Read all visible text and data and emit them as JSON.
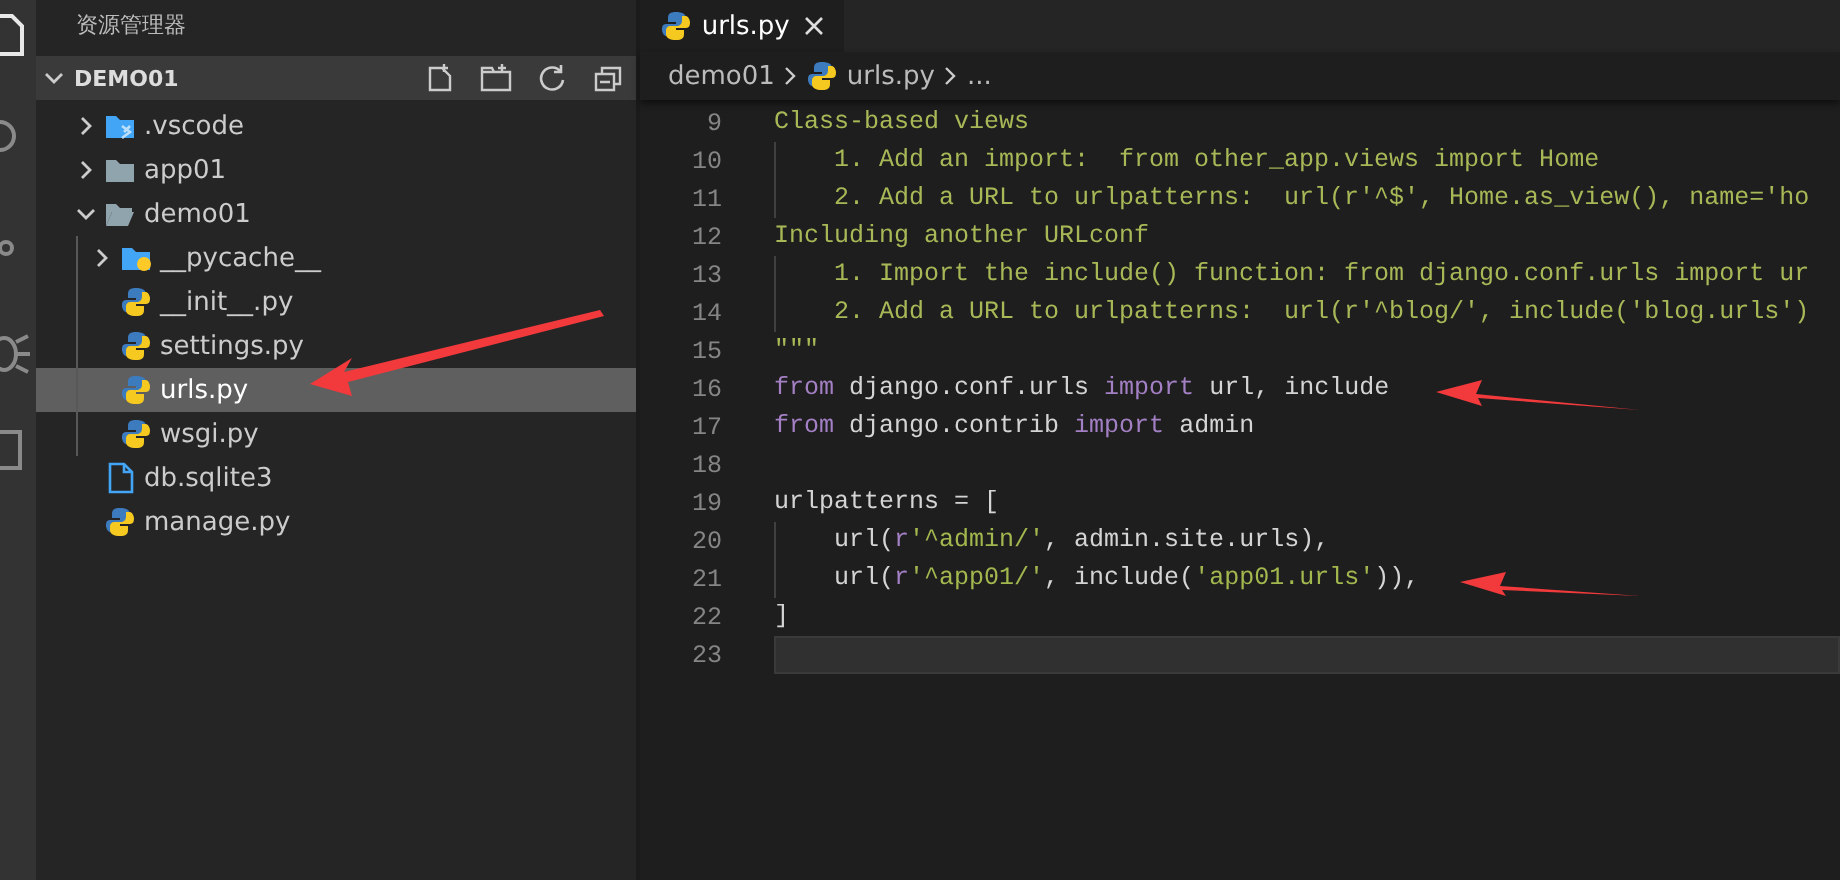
{
  "sidebar": {
    "title": "资源管理器",
    "section": {
      "label": "DEMO01",
      "expanded": true
    },
    "tree": [
      {
        "name": ".vscode",
        "kind": "folder-vscode",
        "expanded": false,
        "selected": false
      },
      {
        "name": "app01",
        "kind": "folder",
        "expanded": false,
        "selected": false
      },
      {
        "name": "demo01",
        "kind": "folder",
        "expanded": true,
        "selected": false,
        "children": [
          {
            "name": "__pycache__",
            "kind": "folder-python",
            "expanded": false,
            "selected": false
          },
          {
            "name": "__init__.py",
            "kind": "python",
            "selected": false
          },
          {
            "name": "settings.py",
            "kind": "python",
            "selected": false
          },
          {
            "name": "urls.py",
            "kind": "python",
            "selected": true
          },
          {
            "name": "wsgi.py",
            "kind": "python",
            "selected": false
          }
        ]
      },
      {
        "name": "db.sqlite3",
        "kind": "file",
        "selected": false
      },
      {
        "name": "manage.py",
        "kind": "python",
        "selected": false
      }
    ]
  },
  "tabs": [
    {
      "label": "urls.py",
      "selected": true
    }
  ],
  "breadcrumb": [
    "demo01",
    "urls.py",
    "..."
  ],
  "code": [
    {
      "number": "9",
      "indent_guide": false,
      "current": false,
      "segments": [
        {
          "kind": "doc",
          "text": "Class-based views"
        }
      ]
    },
    {
      "number": "10",
      "indent_guide": true,
      "current": false,
      "segments": [
        {
          "kind": "doc",
          "text": "    1. Add an import:  from other_app.views import Home"
        }
      ]
    },
    {
      "number": "11",
      "indent_guide": true,
      "current": false,
      "segments": [
        {
          "kind": "doc",
          "text": "    2. Add a URL to urlpatterns:  url(r'^$', Home.as_view(), name='ho"
        }
      ]
    },
    {
      "number": "12",
      "indent_guide": false,
      "current": false,
      "segments": [
        {
          "kind": "doc",
          "text": "Including another URLconf"
        }
      ]
    },
    {
      "number": "13",
      "indent_guide": true,
      "current": false,
      "segments": [
        {
          "kind": "doc",
          "text": "    1. Import the include() function: from django.conf.urls import ur"
        }
      ]
    },
    {
      "number": "14",
      "indent_guide": true,
      "current": false,
      "segments": [
        {
          "kind": "doc",
          "text": "    2. Add a URL to urlpatterns:  url(r'^blog/', include('blog.urls')"
        }
      ]
    },
    {
      "number": "15",
      "indent_guide": false,
      "current": false,
      "segments": [
        {
          "kind": "doc",
          "text": "\"\"\""
        }
      ]
    },
    {
      "number": "16",
      "indent_guide": false,
      "current": false,
      "segments": [
        {
          "kind": "kw",
          "text": "from"
        },
        {
          "kind": "plain",
          "text": " django.conf.urls "
        },
        {
          "kind": "kw",
          "text": "import"
        },
        {
          "kind": "plain",
          "text": " url, include"
        }
      ]
    },
    {
      "number": "17",
      "indent_guide": false,
      "current": false,
      "segments": [
        {
          "kind": "kw",
          "text": "from"
        },
        {
          "kind": "plain",
          "text": " django.contrib "
        },
        {
          "kind": "kw",
          "text": "import"
        },
        {
          "kind": "plain",
          "text": " admin"
        }
      ]
    },
    {
      "number": "18",
      "indent_guide": false,
      "current": false
    },
    {
      "number": "19",
      "indent_guide": false,
      "current": false,
      "segments": [
        {
          "kind": "plain",
          "text": "urlpatterns = ["
        }
      ]
    },
    {
      "number": "20",
      "indent_guide": true,
      "current": false,
      "segments": [
        {
          "kind": "plain",
          "text": "    url("
        },
        {
          "kind": "kw",
          "text": "r"
        },
        {
          "kind": "str",
          "text": "'^admin/'"
        },
        {
          "kind": "plain",
          "text": ", admin.site.urls),"
        }
      ]
    },
    {
      "number": "21",
      "indent_guide": true,
      "current": false,
      "segments": [
        {
          "kind": "plain",
          "text": "    url("
        },
        {
          "kind": "kw",
          "text": "r"
        },
        {
          "kind": "str",
          "text": "'^app01/'"
        },
        {
          "kind": "plain",
          "text": ", include("
        },
        {
          "kind": "str",
          "text": "'app01.urls'"
        },
        {
          "kind": "plain",
          "text": ")),"
        }
      ]
    },
    {
      "number": "22",
      "indent_guide": false,
      "current": false,
      "segments": [
        {
          "kind": "plain",
          "text": "]"
        }
      ]
    },
    {
      "number": "23",
      "indent_guide": false,
      "current": true
    }
  ]
}
